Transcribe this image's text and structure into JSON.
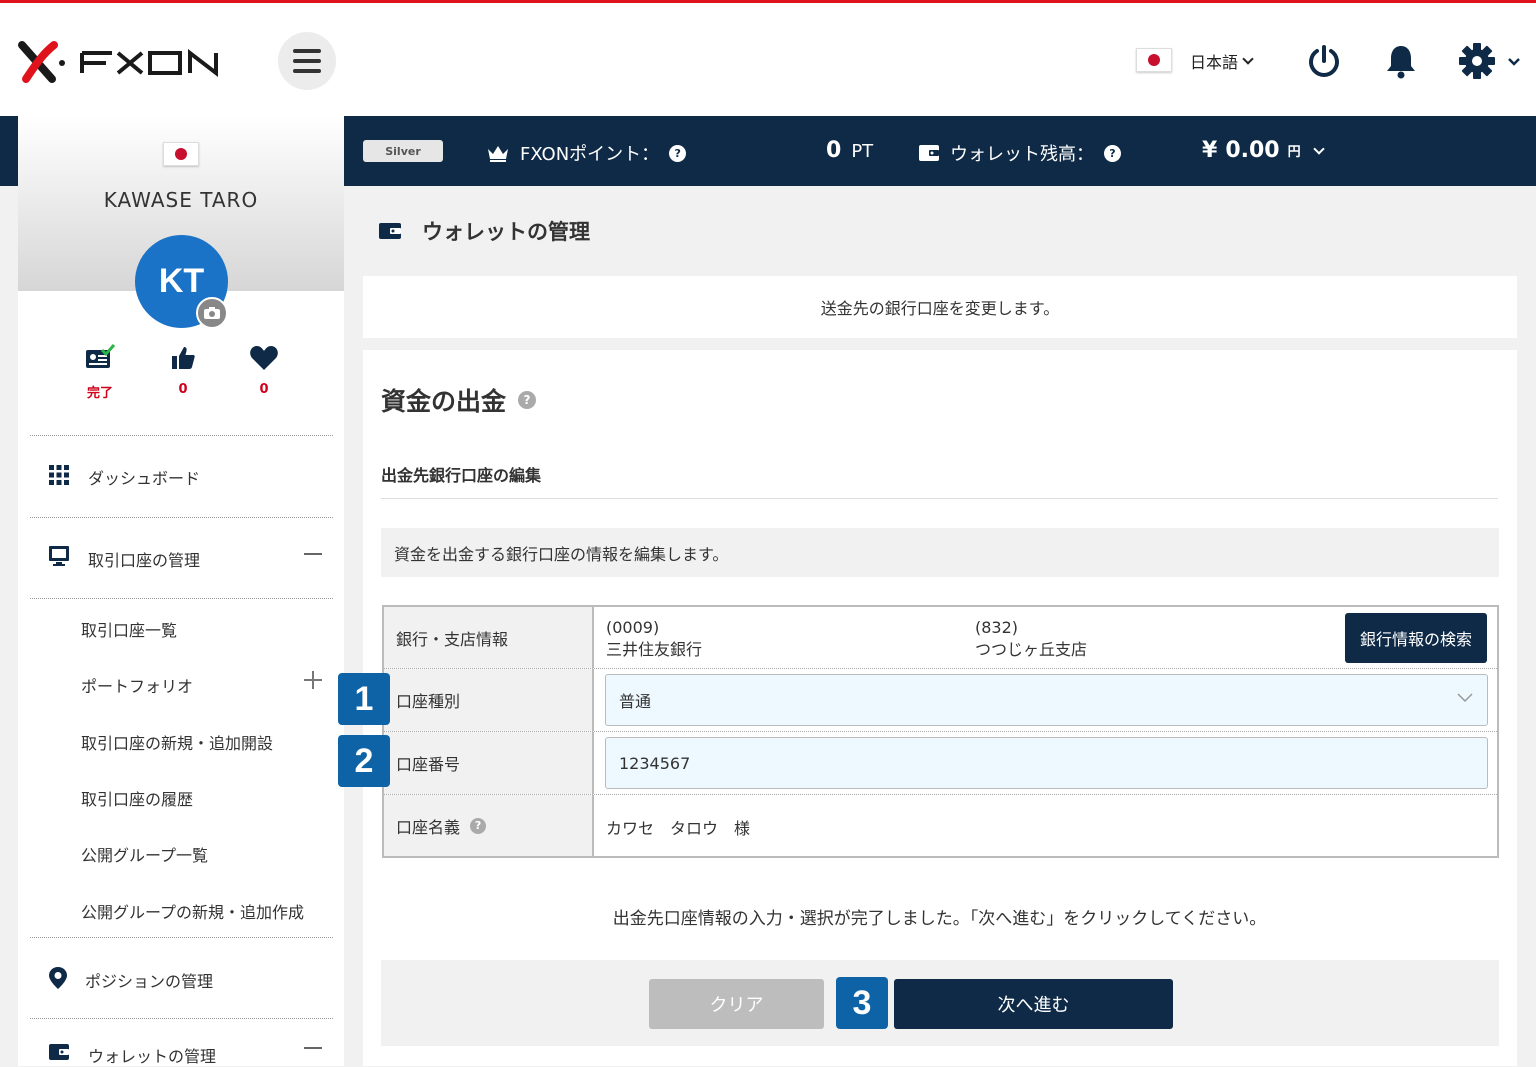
{
  "header": {
    "logo_text": "FXON",
    "language": "日本語"
  },
  "navbar": {
    "rank": "Silver",
    "points_label": "FXONポイント：",
    "points_value": "0",
    "points_unit": "PT",
    "wallet_label": "ウォレット残高：",
    "wallet_currency_symbol": "¥",
    "wallet_value": "0.00",
    "wallet_unit": "円"
  },
  "profile": {
    "name": "KAWASE TARO",
    "initials": "KT",
    "stats": [
      {
        "icon": "id-card-check-icon",
        "value": "完了"
      },
      {
        "icon": "thumbs-up-icon",
        "value": "0"
      },
      {
        "icon": "heart-icon",
        "value": "0"
      }
    ]
  },
  "sidebar": {
    "dashboard": "ダッシュボード",
    "accounts": "取引口座の管理",
    "account_items": [
      "取引口座一覧",
      "ポートフォリオ",
      "取引口座の新規・追加開設",
      "取引口座の履歴",
      "公開グループ一覧",
      "公開グループの新規・追加作成"
    ],
    "positions": "ポジションの管理",
    "wallet": "ウォレットの管理"
  },
  "main": {
    "page_title": "ウォレットの管理",
    "info_text": "送金先の銀行口座を変更します。",
    "section_title": "資金の出金",
    "subsection_title": "出金先銀行口座の編集",
    "note": "資金を出金する銀行口座の情報を編集します。",
    "table": {
      "bank_label": "銀行・支店情報",
      "bank_code": "(0009)",
      "bank_name": "三井住友銀行",
      "branch_code": "(832)",
      "branch_name": "つつじヶ丘支店",
      "search_button": "銀行情報の検索",
      "type_label": "口座種別",
      "type_value": "普通",
      "number_label": "口座番号",
      "number_value": "1234567",
      "holder_label": "口座名義",
      "holder_value": "カワセ　タロウ　様"
    },
    "complete_message": "出金先口座情報の入力・選択が完了しました。「次へ進む」をクリックしてください。",
    "clear_button": "クリア",
    "next_button": "次へ進む"
  },
  "markers": [
    "1",
    "2",
    "3"
  ],
  "colors": {
    "accent_red": "#e0121b",
    "navy": "#0e2a46",
    "blue": "#1a73c6",
    "marker_blue": "#0d63a6"
  }
}
